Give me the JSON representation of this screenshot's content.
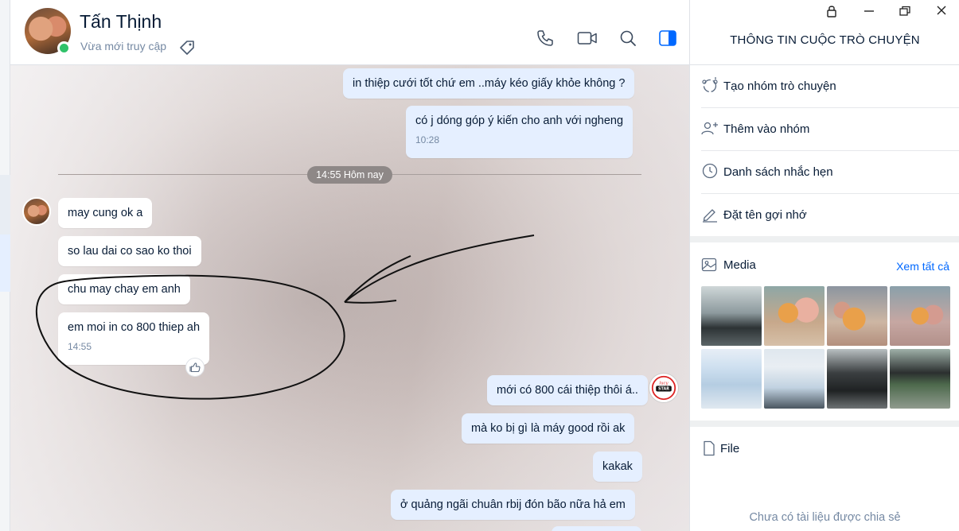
{
  "header": {
    "name": "Tấn Thịnh",
    "status": "Vừa mới truy cập"
  },
  "messages": {
    "m1": "in thiệp cưới tốt chứ em ..máy kéo giấy khỏe không ?",
    "m2": "có j dóng góp ý kiến cho anh với ngheng",
    "m2_time": "10:28",
    "divider": "14:55 Hôm nay",
    "t1": "may cung ok a",
    "t2": "so lau dai co sao ko thoi",
    "t3": "chu may chay em anh",
    "t4": "em moi in co 800 thiep ah",
    "t4_time": "14:55",
    "m3": "mới có 800 cái thiệp thôi á..",
    "m4": "mà ko bị gì là máy good rồi ak",
    "m5": "kakak",
    "m6": "ở quảng ngãi chuân rbij đón bão nữa hả em"
  },
  "panel": {
    "title": "THÔNG TIN CUỘC TRÒ CHUYỆN",
    "menu": [
      {
        "label": "Tạo nhóm trò chuyện",
        "icon": "group-create-icon"
      },
      {
        "label": "Thêm vào nhóm",
        "icon": "add-to-group-icon"
      },
      {
        "label": "Danh sách nhắc hẹn",
        "icon": "clock-icon"
      },
      {
        "label": "Đặt tên gợi nhớ",
        "icon": "pencil-icon"
      }
    ],
    "media_title": "Media",
    "see_all": "Xem tất cả",
    "file_title": "File",
    "file_empty": "Chưa có tài liệu được chia sẻ"
  },
  "colors": {
    "accent": "#0068ff",
    "my_bubble": "#e5efff",
    "online": "#30c26a"
  }
}
